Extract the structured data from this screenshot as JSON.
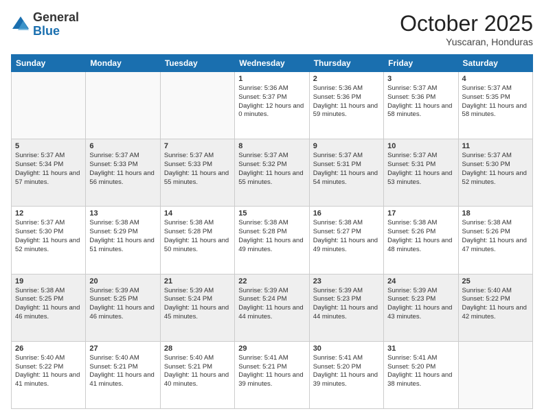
{
  "header": {
    "logo_general": "General",
    "logo_blue": "Blue",
    "month_title": "October 2025",
    "location": "Yuscaran, Honduras"
  },
  "days_of_week": [
    "Sunday",
    "Monday",
    "Tuesday",
    "Wednesday",
    "Thursday",
    "Friday",
    "Saturday"
  ],
  "weeks": [
    [
      {
        "day": "",
        "info": ""
      },
      {
        "day": "",
        "info": ""
      },
      {
        "day": "",
        "info": ""
      },
      {
        "day": "1",
        "info": "Sunrise: 5:36 AM\nSunset: 5:37 PM\nDaylight: 12 hours\nand 0 minutes."
      },
      {
        "day": "2",
        "info": "Sunrise: 5:36 AM\nSunset: 5:36 PM\nDaylight: 11 hours\nand 59 minutes."
      },
      {
        "day": "3",
        "info": "Sunrise: 5:37 AM\nSunset: 5:36 PM\nDaylight: 11 hours\nand 58 minutes."
      },
      {
        "day": "4",
        "info": "Sunrise: 5:37 AM\nSunset: 5:35 PM\nDaylight: 11 hours\nand 58 minutes."
      }
    ],
    [
      {
        "day": "5",
        "info": "Sunrise: 5:37 AM\nSunset: 5:34 PM\nDaylight: 11 hours\nand 57 minutes."
      },
      {
        "day": "6",
        "info": "Sunrise: 5:37 AM\nSunset: 5:33 PM\nDaylight: 11 hours\nand 56 minutes."
      },
      {
        "day": "7",
        "info": "Sunrise: 5:37 AM\nSunset: 5:33 PM\nDaylight: 11 hours\nand 55 minutes."
      },
      {
        "day": "8",
        "info": "Sunrise: 5:37 AM\nSunset: 5:32 PM\nDaylight: 11 hours\nand 55 minutes."
      },
      {
        "day": "9",
        "info": "Sunrise: 5:37 AM\nSunset: 5:31 PM\nDaylight: 11 hours\nand 54 minutes."
      },
      {
        "day": "10",
        "info": "Sunrise: 5:37 AM\nSunset: 5:31 PM\nDaylight: 11 hours\nand 53 minutes."
      },
      {
        "day": "11",
        "info": "Sunrise: 5:37 AM\nSunset: 5:30 PM\nDaylight: 11 hours\nand 52 minutes."
      }
    ],
    [
      {
        "day": "12",
        "info": "Sunrise: 5:37 AM\nSunset: 5:30 PM\nDaylight: 11 hours\nand 52 minutes."
      },
      {
        "day": "13",
        "info": "Sunrise: 5:38 AM\nSunset: 5:29 PM\nDaylight: 11 hours\nand 51 minutes."
      },
      {
        "day": "14",
        "info": "Sunrise: 5:38 AM\nSunset: 5:28 PM\nDaylight: 11 hours\nand 50 minutes."
      },
      {
        "day": "15",
        "info": "Sunrise: 5:38 AM\nSunset: 5:28 PM\nDaylight: 11 hours\nand 49 minutes."
      },
      {
        "day": "16",
        "info": "Sunrise: 5:38 AM\nSunset: 5:27 PM\nDaylight: 11 hours\nand 49 minutes."
      },
      {
        "day": "17",
        "info": "Sunrise: 5:38 AM\nSunset: 5:26 PM\nDaylight: 11 hours\nand 48 minutes."
      },
      {
        "day": "18",
        "info": "Sunrise: 5:38 AM\nSunset: 5:26 PM\nDaylight: 11 hours\nand 47 minutes."
      }
    ],
    [
      {
        "day": "19",
        "info": "Sunrise: 5:38 AM\nSunset: 5:25 PM\nDaylight: 11 hours\nand 46 minutes."
      },
      {
        "day": "20",
        "info": "Sunrise: 5:39 AM\nSunset: 5:25 PM\nDaylight: 11 hours\nand 46 minutes."
      },
      {
        "day": "21",
        "info": "Sunrise: 5:39 AM\nSunset: 5:24 PM\nDaylight: 11 hours\nand 45 minutes."
      },
      {
        "day": "22",
        "info": "Sunrise: 5:39 AM\nSunset: 5:24 PM\nDaylight: 11 hours\nand 44 minutes."
      },
      {
        "day": "23",
        "info": "Sunrise: 5:39 AM\nSunset: 5:23 PM\nDaylight: 11 hours\nand 44 minutes."
      },
      {
        "day": "24",
        "info": "Sunrise: 5:39 AM\nSunset: 5:23 PM\nDaylight: 11 hours\nand 43 minutes."
      },
      {
        "day": "25",
        "info": "Sunrise: 5:40 AM\nSunset: 5:22 PM\nDaylight: 11 hours\nand 42 minutes."
      }
    ],
    [
      {
        "day": "26",
        "info": "Sunrise: 5:40 AM\nSunset: 5:22 PM\nDaylight: 11 hours\nand 41 minutes."
      },
      {
        "day": "27",
        "info": "Sunrise: 5:40 AM\nSunset: 5:21 PM\nDaylight: 11 hours\nand 41 minutes."
      },
      {
        "day": "28",
        "info": "Sunrise: 5:40 AM\nSunset: 5:21 PM\nDaylight: 11 hours\nand 40 minutes."
      },
      {
        "day": "29",
        "info": "Sunrise: 5:41 AM\nSunset: 5:21 PM\nDaylight: 11 hours\nand 39 minutes."
      },
      {
        "day": "30",
        "info": "Sunrise: 5:41 AM\nSunset: 5:20 PM\nDaylight: 11 hours\nand 39 minutes."
      },
      {
        "day": "31",
        "info": "Sunrise: 5:41 AM\nSunset: 5:20 PM\nDaylight: 11 hours\nand 38 minutes."
      },
      {
        "day": "",
        "info": ""
      }
    ]
  ]
}
